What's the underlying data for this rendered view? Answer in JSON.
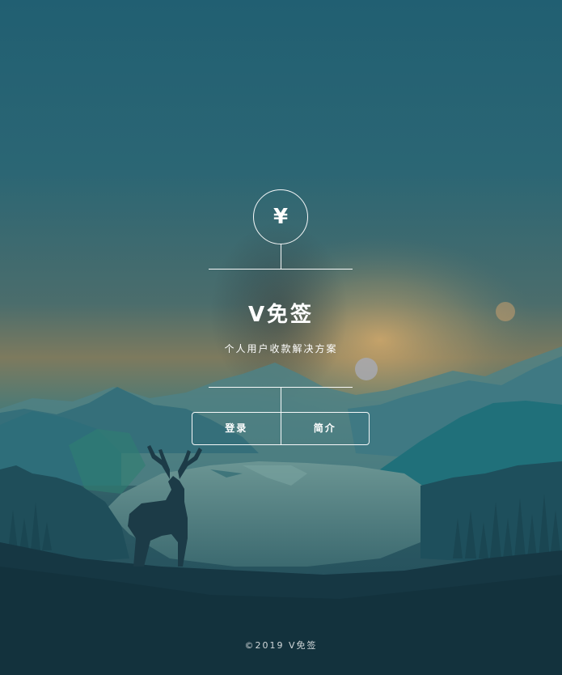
{
  "logo": {
    "symbol": "¥"
  },
  "header": {
    "title": "V免签",
    "subtitle": "个人用户收款解决方案"
  },
  "actions": {
    "login_label": "登录",
    "intro_label": "简介"
  },
  "footer": {
    "copyright": "©2019 V免签"
  },
  "colors": {
    "sky_top": "#215f72",
    "horizon_glow": "#c9a26a",
    "lake": "#4c7d7f",
    "foreground": "#1b3a45",
    "line": "#ffffff"
  },
  "background_icons": [
    "mountains-illustration",
    "deer-silhouette-icon",
    "sun-glow",
    "moon-icon",
    "pine-forest"
  ]
}
